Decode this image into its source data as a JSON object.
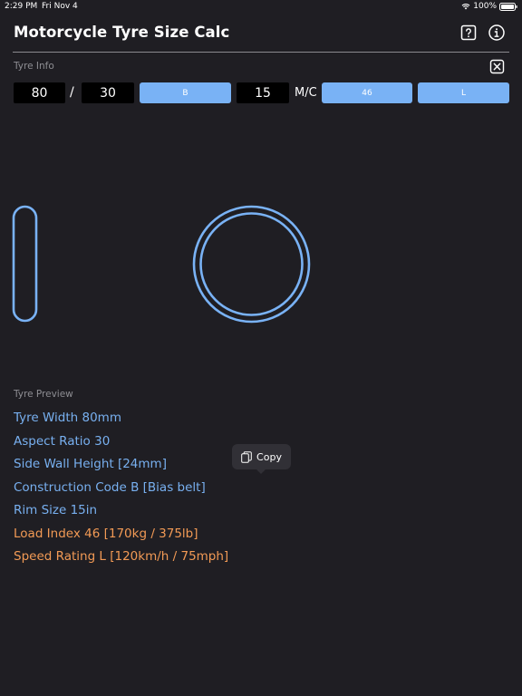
{
  "status_bar": {
    "time": "2:29 PM",
    "date": "Fri Nov 4",
    "battery": "100%"
  },
  "header": {
    "title": "Motorcycle Tyre Size Calc"
  },
  "tyre_info": {
    "label": "Tyre Info",
    "width": "80",
    "separator": "/",
    "aspect_ratio": "30",
    "construction_code": "B",
    "rim_size": "15",
    "mc_label": "M/C",
    "load_index": "46",
    "speed_rating": "L"
  },
  "preview": {
    "label": "Tyre Preview",
    "lines": [
      "Tyre Width 80mm",
      "Aspect Ratio 30",
      "Side Wall Height [24mm]",
      "Construction Code B [Bias belt]",
      "Rim Size 15in",
      "Load Index 46 [170kg / 375lb]",
      "Speed Rating L [120km/h / 75mph]"
    ]
  },
  "copy_popup": {
    "label": "Copy"
  },
  "colors": {
    "background": "#1f1e23",
    "accent_blue": "#79b2f5",
    "text_blue": "#78b0f0",
    "text_orange": "#f29a55",
    "field_background": "#000000"
  }
}
